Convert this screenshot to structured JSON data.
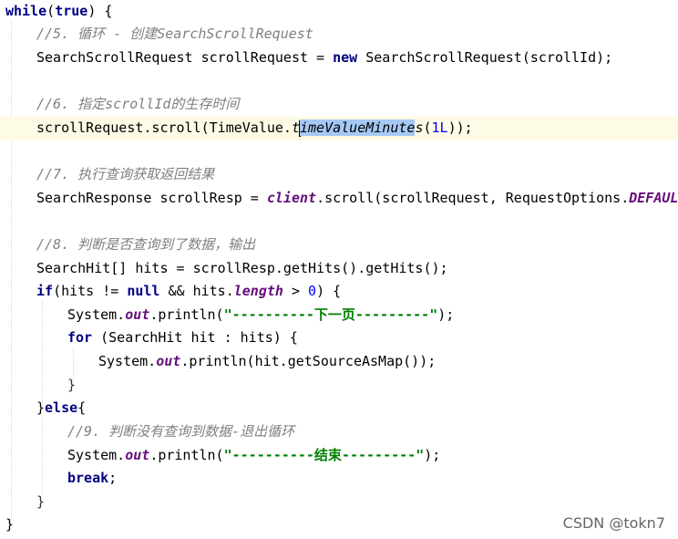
{
  "editor": {
    "lines": [
      {
        "tokens": [
          {
            "t": "while",
            "c": "kw"
          },
          {
            "t": "(",
            "c": ""
          },
          {
            "t": "true",
            "c": "kw"
          },
          {
            "t": ") {",
            "c": ""
          }
        ]
      },
      {
        "tokens": [
          {
            "t": "//5. 循环 - 创建SearchScrollRequest",
            "c": "cm"
          }
        ]
      },
      {
        "tokens": [
          {
            "t": "SearchScrollRequest scrollRequest = ",
            "c": ""
          },
          {
            "t": "new",
            "c": "kw"
          },
          {
            "t": " SearchScrollRequest(scrollId);",
            "c": ""
          }
        ]
      },
      {
        "tokens": []
      },
      {
        "tokens": [
          {
            "t": "//6. 指定scrollId的生存时间",
            "c": "cm"
          }
        ]
      },
      {
        "tokens": [
          {
            "t": "scrollRequest.scroll(TimeValue.",
            "c": ""
          },
          {
            "t": "t",
            "c": "sm"
          },
          {
            "t": "caret",
            "c": "caret"
          },
          {
            "t": "imeValueMinute",
            "c": "sm sel"
          },
          {
            "t": "s",
            "c": "sm"
          },
          {
            "t": "(",
            "c": ""
          },
          {
            "t": "1L",
            "c": "num"
          },
          {
            "t": "));",
            "c": ""
          }
        ]
      },
      {
        "tokens": []
      },
      {
        "tokens": [
          {
            "t": "//7. 执行查询获取返回结果",
            "c": "cm"
          }
        ]
      },
      {
        "tokens": [
          {
            "t": "SearchResponse scrollResp = ",
            "c": ""
          },
          {
            "t": "client",
            "c": "fld"
          },
          {
            "t": ".scroll(scrollRequest, RequestOptions.",
            "c": ""
          },
          {
            "t": "DEFAULT",
            "c": "fld"
          },
          {
            "t": ");",
            "c": ""
          }
        ]
      },
      {
        "tokens": []
      },
      {
        "tokens": [
          {
            "t": "//8. 判断是否查询到了数据，输出",
            "c": "cm"
          }
        ]
      },
      {
        "tokens": [
          {
            "t": "SearchHit[] hits = scrollResp.getHits().getHits();",
            "c": ""
          }
        ]
      },
      {
        "tokens": [
          {
            "t": "if",
            "c": "kw"
          },
          {
            "t": "(hits != ",
            "c": ""
          },
          {
            "t": "null",
            "c": "kw"
          },
          {
            "t": " && hits.",
            "c": ""
          },
          {
            "t": "length",
            "c": "fld"
          },
          {
            "t": " > ",
            "c": ""
          },
          {
            "t": "0",
            "c": "num"
          },
          {
            "t": ") {",
            "c": ""
          }
        ]
      },
      {
        "tokens": [
          {
            "t": "System.",
            "c": ""
          },
          {
            "t": "out",
            "c": "fld"
          },
          {
            "t": ".println(",
            "c": ""
          },
          {
            "t": "\"----------下一页---------\"",
            "c": "st"
          },
          {
            "t": ");",
            "c": ""
          }
        ]
      },
      {
        "tokens": [
          {
            "t": "for",
            "c": "kw"
          },
          {
            "t": " (SearchHit hit : hits) {",
            "c": ""
          }
        ]
      },
      {
        "tokens": [
          {
            "t": "System.",
            "c": ""
          },
          {
            "t": "out",
            "c": "fld"
          },
          {
            "t": ".println(hit.getSourceAsMap());",
            "c": ""
          }
        ]
      },
      {
        "tokens": [
          {
            "t": "}",
            "c": "dim"
          }
        ]
      },
      {
        "tokens": [
          {
            "t": "}",
            "c": ""
          },
          {
            "t": "else",
            "c": "kw"
          },
          {
            "t": "{",
            "c": ""
          }
        ]
      },
      {
        "tokens": [
          {
            "t": "//9. 判断没有查询到数据-退出循环",
            "c": "cm"
          }
        ]
      },
      {
        "tokens": [
          {
            "t": "System.",
            "c": ""
          },
          {
            "t": "out",
            "c": "fld"
          },
          {
            "t": ".println(",
            "c": ""
          },
          {
            "t": "\"----------结束---------\"",
            "c": "st"
          },
          {
            "t": ");",
            "c": ""
          }
        ]
      },
      {
        "tokens": [
          {
            "t": "break",
            "c": "kw"
          },
          {
            "t": ";",
            "c": ""
          }
        ]
      },
      {
        "tokens": [
          {
            "t": "}",
            "c": "dim"
          }
        ]
      },
      {
        "tokens": [
          {
            "t": "}",
            "c": ""
          }
        ]
      }
    ]
  },
  "watermark": "CSDN @tokn7"
}
